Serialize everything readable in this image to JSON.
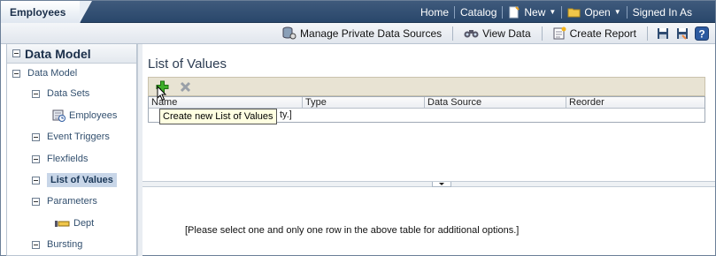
{
  "app": {
    "tab_label": "Employees"
  },
  "topnav": {
    "home": "Home",
    "catalog": "Catalog",
    "new": "New",
    "open": "Open",
    "signed_in": "Signed In As"
  },
  "toolbar": {
    "manage_private": "Manage Private Data Sources",
    "view_data": "View Data",
    "create_report": "Create Report"
  },
  "left_panel": {
    "header": "Data Model",
    "tree": [
      {
        "label": "Data Model"
      },
      {
        "label": "Data Sets"
      },
      {
        "label": "Employees"
      },
      {
        "label": "Event Triggers"
      },
      {
        "label": "Flexfields"
      },
      {
        "label": "List of Values",
        "selected": true
      },
      {
        "label": "Parameters"
      },
      {
        "label": "Dept"
      },
      {
        "label": "Bursting"
      }
    ]
  },
  "main": {
    "title": "List of Values",
    "columns": [
      "Name",
      "Type",
      "Data Source",
      "Reorder"
    ],
    "empty_fragment": "ty.]",
    "tooltip": "Create new List of Values",
    "detail_message": "[Please select one and only one row in the above table for additional options.]"
  },
  "colors": {
    "topbar": "#29476b",
    "selected_node": "#c8d6e8",
    "table_toolbar": "#e8e3d3"
  }
}
